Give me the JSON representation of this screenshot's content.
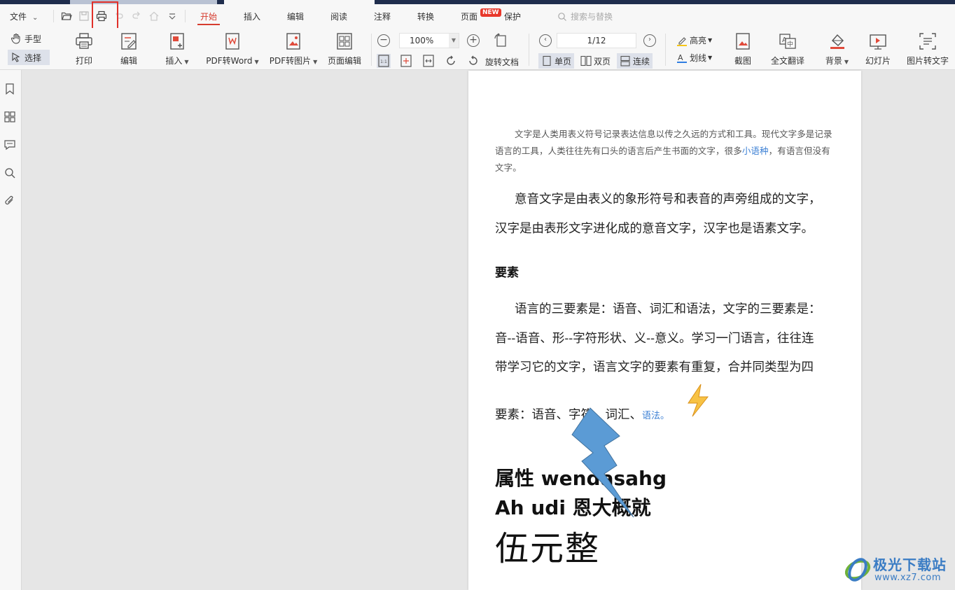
{
  "menubar": {
    "file_label": "文件",
    "tabs": [
      {
        "label": "开始",
        "active": true
      },
      {
        "label": "插入"
      },
      {
        "label": "编辑"
      },
      {
        "label": "阅读"
      },
      {
        "label": "注释"
      },
      {
        "label": "转换"
      },
      {
        "label": "页面"
      },
      {
        "label": "保护"
      }
    ],
    "new_badge": "NEW",
    "search_placeholder": "搜索与替换"
  },
  "toolbar": {
    "hand_label": "手型",
    "select_label": "选择",
    "print_label": "打印",
    "edit_label": "编辑",
    "insert_label": "插入",
    "pdf_to_word_label": "PDF转Word",
    "pdf_to_image_label": "PDF转图片",
    "page_edit_label": "页面编辑",
    "zoom_value": "100%",
    "rotate_doc_label": "旋转文档",
    "page_indicator": "1/12",
    "single_page_label": "单页",
    "double_page_label": "双页",
    "continuous_label": "连续",
    "highlight_label": "高亮",
    "underline_label": "划线",
    "screenshot_label": "截图",
    "translate_label": "全文翻译",
    "background_label": "背景",
    "slideshow_label": "幻灯片",
    "img_to_text_label": "图片转文字"
  },
  "document": {
    "para1_text": "文字是人类用表义符号记录表达信息以传之久远的方式和工具。现代文字多是记录语言的工具，人类往往先有口头的语言后产生书面的文字，很多",
    "para1_link": "小语种",
    "para1_tail": "，有语言但没有文字。",
    "para2_line1": "意音文字是由表义的象形符号和表音的声旁组成的文字，",
    "para2_line2": "汉字是由表形文字进化成的意音文字，汉字也是语素文字。",
    "heading": "要素",
    "para3_line1": "语言的三要素是：语音、词汇和语法，文字的三要素是：",
    "para3_line2": "音--语音、形--字符形状、义--意义。学习一门语言，往往连",
    "para3_line3": "带学习它的文字，语言文字的要素有重复，合并同类型为四",
    "para4_text": "要素：语音、字符、词汇、",
    "para4_link": "语法。",
    "big_line1": "属性 wendasahg",
    "big_line2": "Ah udi 恩大概就",
    "huge_line": "伍元整"
  },
  "watermark": {
    "text": "极光下载站",
    "url": "www.xz7.com"
  },
  "colors": {
    "accent": "#d63c2f",
    "link": "#3b7fd4",
    "highlight_box": "#e0302a",
    "shape_fill": "#5b9bd5"
  }
}
